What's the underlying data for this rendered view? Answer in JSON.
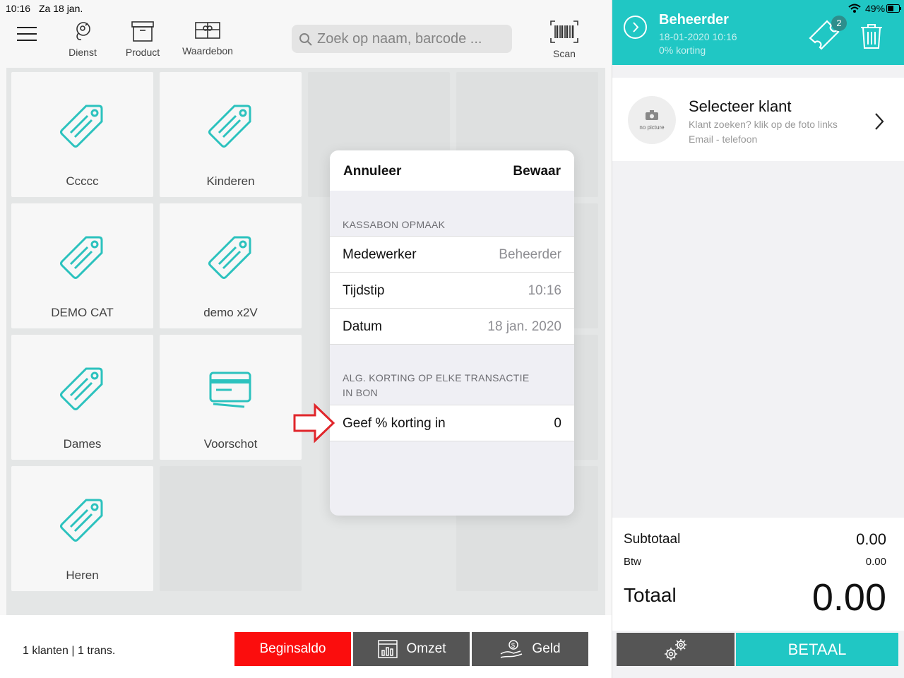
{
  "status": {
    "time": "10:16",
    "date": "Za 18 jan.",
    "battery": "49%"
  },
  "toolbar": {
    "dienst_label": "Dienst",
    "product_label": "Product",
    "waardebon_label": "Waardebon",
    "scan_label": "Scan",
    "search_placeholder": "Zoek op naam, barcode ..."
  },
  "tiles": [
    {
      "label": "Ccccc",
      "icon": "tag-icon"
    },
    {
      "label": "Kinderen",
      "icon": "tag-icon"
    },
    {
      "label": "DEMO CAT",
      "icon": "tag-icon"
    },
    {
      "label": "demo x2V",
      "icon": "tag-icon"
    },
    {
      "label": "Dames",
      "icon": "tag-icon"
    },
    {
      "label": "Voorschot",
      "icon": "credit-card-icon"
    },
    {
      "label": "Heren",
      "icon": "tag-icon"
    }
  ],
  "modal": {
    "cancel_label": "Annuleer",
    "save_label": "Bewaar",
    "section1_label": "KASSABON OPMAAK",
    "rows": [
      {
        "label": "Medewerker",
        "value": "Beheerder"
      },
      {
        "label": "Tijdstip",
        "value": "10:16"
      },
      {
        "label": "Datum",
        "value": "18 jan. 2020"
      }
    ],
    "section2_line1": "ALG. KORTING OP ELKE TRANSACTIE",
    "section2_line2": "IN BON",
    "discount_label": "Geef % korting in",
    "discount_value": "0"
  },
  "bottom": {
    "clients_text": "1 klanten | 1 trans.",
    "beginsaldo_label": "Beginsaldo",
    "omzet_label": "Omzet",
    "geld_label": "Geld"
  },
  "right": {
    "user_name": "Beheerder",
    "user_datetime": "18-01-2020 10:16",
    "user_discount": "0% korting",
    "ticket_count": "2",
    "customer_title": "Selecteer klant",
    "customer_hint": "Klant zoeken? klik op de foto links",
    "customer_contact": "Email - telefoon",
    "avatar_text": "no picture",
    "subtotal_label": "Subtotaal",
    "subtotal_value": "0.00",
    "btw_label": "Btw",
    "btw_value": "0.00",
    "total_label": "Totaal",
    "total_value": "0.00",
    "pay_label": "BETAAL"
  },
  "colors": {
    "accent": "#20c7c4",
    "danger": "#fb0d0d",
    "dark_button": "#555555"
  }
}
